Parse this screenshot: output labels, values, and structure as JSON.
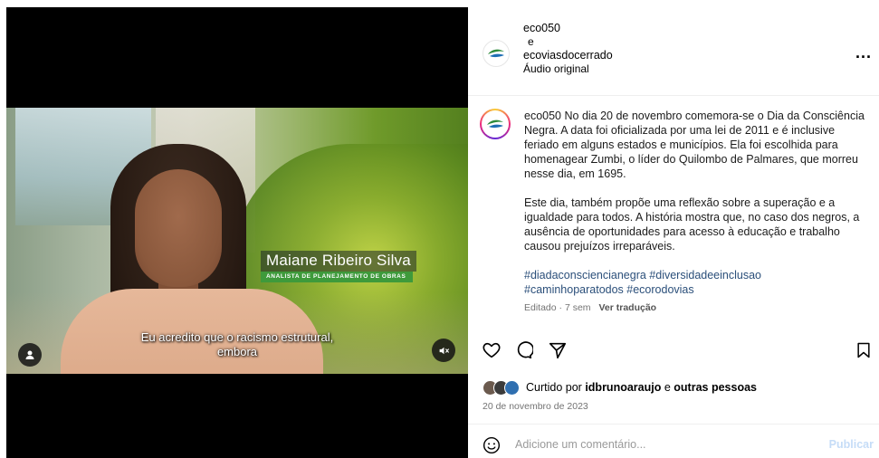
{
  "video": {
    "lower_third_name": "Maiane Ribeiro Silva",
    "lower_third_role": "ANALISTA DE PLANEJAMENTO DE OBRAS",
    "subtitle_line1": "Eu acredito que o racismo estrutural,",
    "subtitle_line2": "embora",
    "icons": {
      "user": "user-icon",
      "mute": "speaker-muted-icon"
    }
  },
  "header": {
    "account1": "eco050",
    "conjunction": "e",
    "account2": "ecoviasdocerrado",
    "audio": "Áudio original",
    "more": "..."
  },
  "caption": {
    "username": "eco050",
    "paragraph1": "No dia 20 de novembro comemora-se o Dia da Consciência Negra. A data foi oficializada por uma lei de 2011 e é inclusive feriado em alguns estados e municípios. Ela foi escolhida para homenagear Zumbi, o líder do Quilombo de Palmares, que morreu nesse dia, em 1695.",
    "paragraph2": "Este dia, também propõe uma reflexão sobre a superação e a igualdade para todos. A história mostra que, no caso dos negros, a ausência de oportunidades para acesso à educação e trabalho causou prejuízos irreparáveis.",
    "hashtags_line1": "#diadaconsciencianegra #diversidadeeinclusao",
    "hashtags_line2": "#caminhoparatodos #ecorodovias",
    "edited": "Editado · 7 sem",
    "translate": "Ver tradução"
  },
  "actions": {
    "icons": [
      "heart-icon",
      "comment-icon",
      "share-icon",
      "bookmark-icon"
    ]
  },
  "likes": {
    "prefix": "Curtido por",
    "user": "idbrunoaraujo",
    "middle": "e",
    "suffix": "outras pessoas"
  },
  "date": "20 de novembro de 2023",
  "comment": {
    "placeholder": "Adicione um comentário...",
    "publish": "Publicar"
  },
  "colors": {
    "brand_green": "#3e9a3b",
    "hashtag": "#2b4f7a",
    "publish_disabled": "#c5dcf7"
  }
}
